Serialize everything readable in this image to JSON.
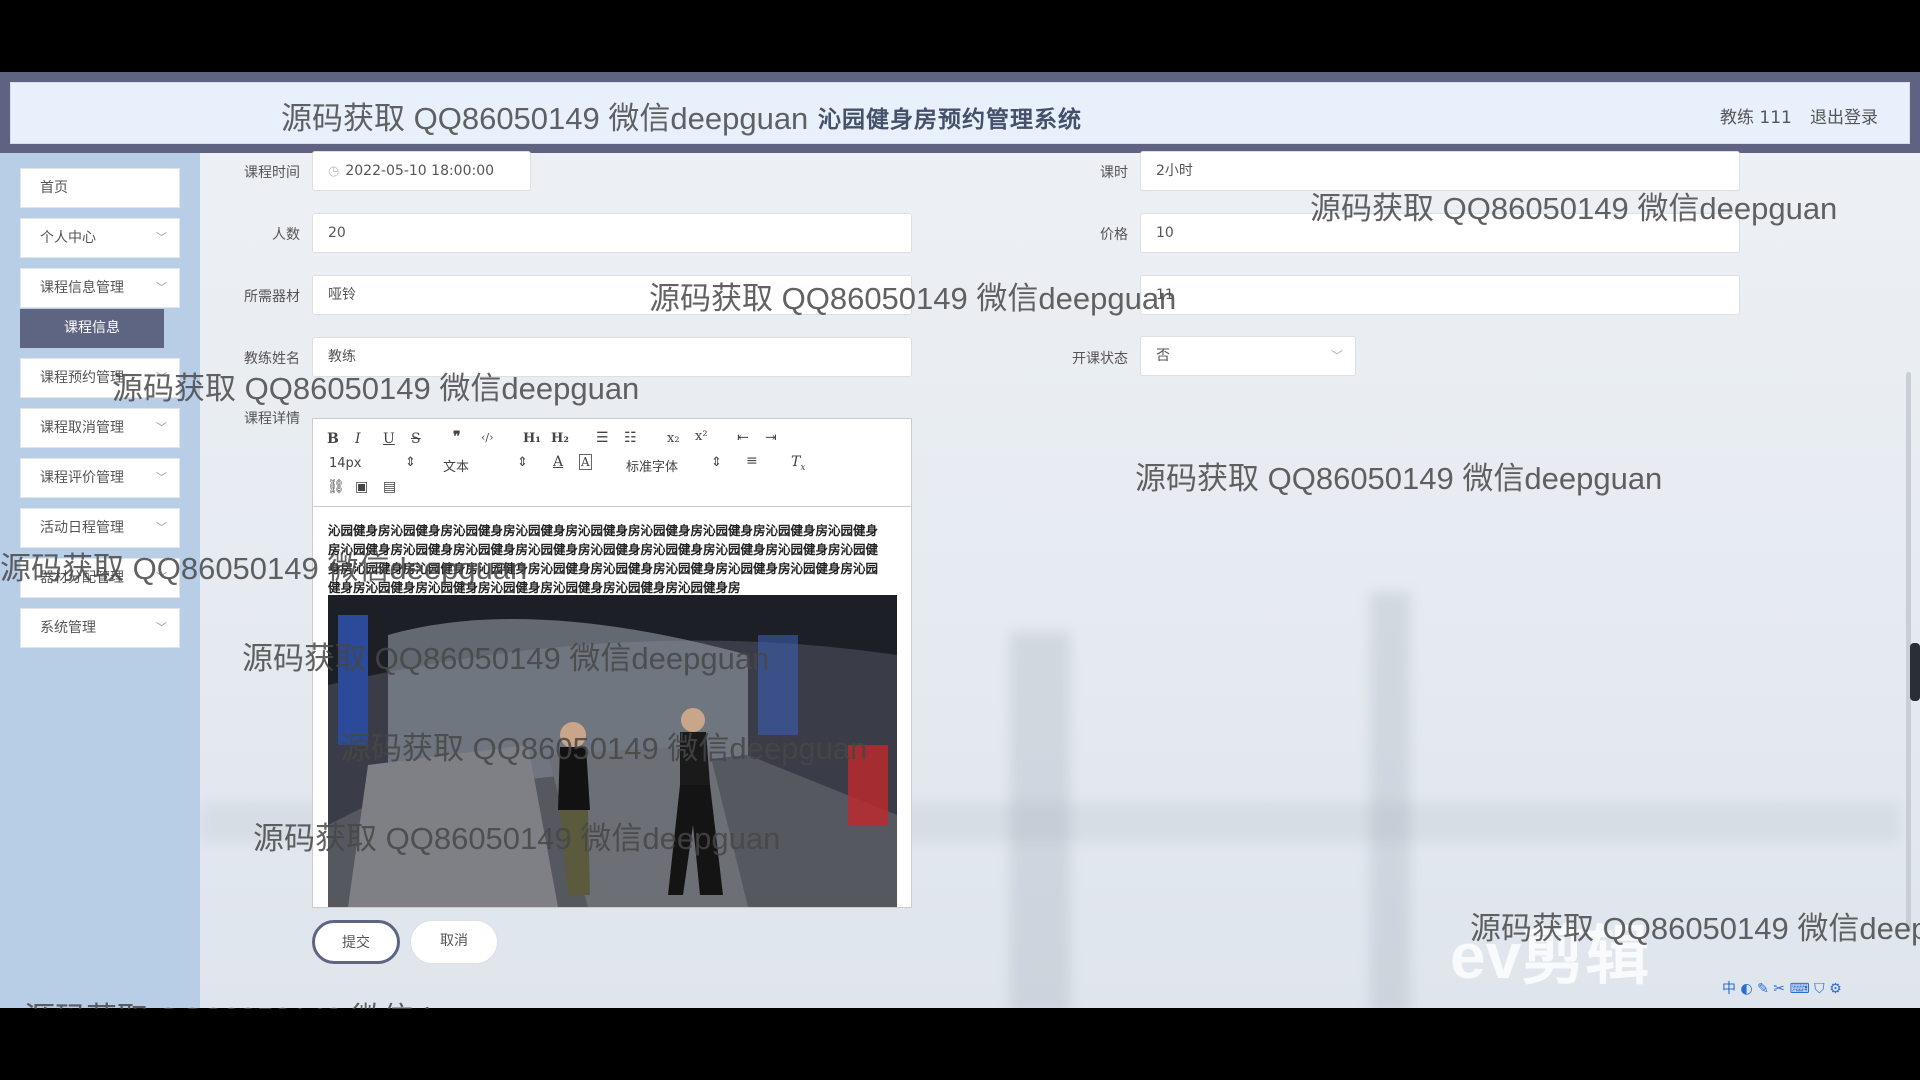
{
  "header": {
    "system_title": "沁园健身房预约管理系统",
    "user": "教练 111",
    "logout": "退出登录"
  },
  "sidebar": {
    "items": [
      {
        "label": "首页"
      },
      {
        "label": "个人中心"
      },
      {
        "label": "课程信息管理"
      },
      {
        "label": "课程预约管理"
      },
      {
        "label": "课程取消管理"
      },
      {
        "label": "课程评价管理"
      },
      {
        "label": "活动日程管理"
      },
      {
        "label": "器材分配管理"
      },
      {
        "label": "系统管理"
      }
    ],
    "active_sub": "课程信息"
  },
  "form": {
    "time_label": "课程时间",
    "time_value": "2022-05-10 18:00:00",
    "hours_label": "课时",
    "hours_value": "2小时",
    "people_label": "人数",
    "people_value": "20",
    "price_label": "价格",
    "price_value": "10",
    "equip_label": "所需器材",
    "equip_value": "哑铃",
    "extra_value": "11",
    "coach_label": "教练姓名",
    "coach_value": "教练",
    "status_label": "开课状态",
    "status_value": "否",
    "detail_label": "课程详情"
  },
  "editor": {
    "font_size": "14px",
    "block_type": "文本",
    "font_family": "标准字体",
    "content": "沁园健身房沁园健身房沁园健身房沁园健身房沁园健身房沁园健身房沁园健身房沁园健身房沁园健身房沁园健身房沁园健身房沁园健身房沁园健身房沁园健身房沁园健身房沁园健身房沁园健身房沁园健身房沁园健身房沁园健身房沁园健身房沁园健身房沁园健身房沁园健身房沁园健身房沁园健身房沁园健身房沁园健身房沁园健身房沁园健身房沁园健身房沁园健身房沁园健身房"
  },
  "buttons": {
    "submit": "提交",
    "cancel": "取消"
  },
  "watermark": {
    "text": "源码获取 QQ86050149 微信deepguan",
    "cut": "源码获取 QQ86050149 微信deep"
  },
  "ime": {
    "label": "中"
  },
  "overlay_logo": "ev剪辑"
}
